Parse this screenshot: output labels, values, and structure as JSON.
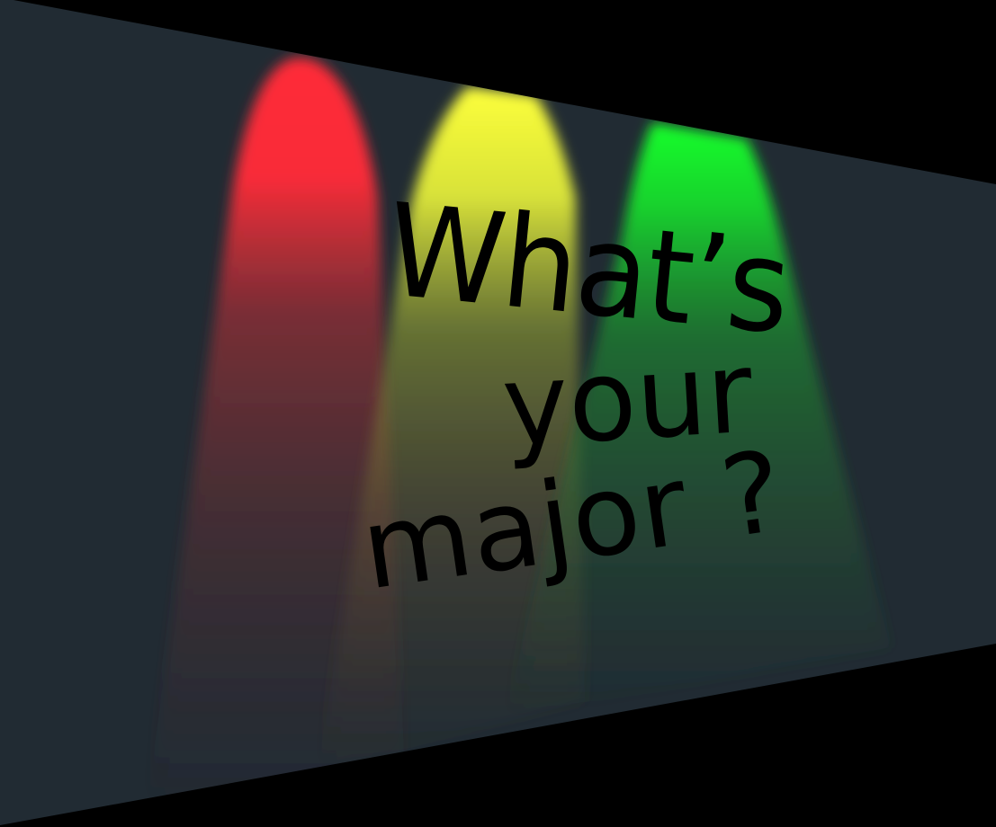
{
  "colors": {
    "background": "#000000",
    "panel": "#212b33",
    "spotlight_red": "#ff2b38",
    "spotlight_yellow": "#fdff3a",
    "spotlight_green": "#12ff2c",
    "text": "#000000"
  },
  "headline": {
    "line1": "What’s",
    "line2": "your",
    "line3": "major ?"
  }
}
